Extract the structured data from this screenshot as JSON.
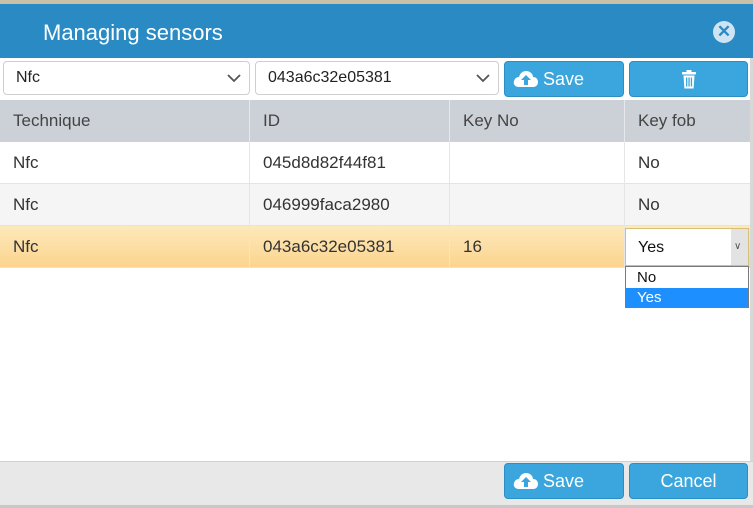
{
  "dialog": {
    "title": "Managing sensors"
  },
  "toolbar": {
    "technique_value": "Nfc",
    "id_value": "043a6c32e05381",
    "save_label": "Save"
  },
  "grid": {
    "columns": [
      "Technique",
      "ID",
      "Key No",
      "Key fob"
    ],
    "rows": [
      {
        "technique": "Nfc",
        "id": "045d8d82f44f81",
        "key_no": "",
        "key_fob": "No"
      },
      {
        "technique": "Nfc",
        "id": "046999faca2980",
        "key_no": "",
        "key_fob": "No"
      },
      {
        "technique": "Nfc",
        "id": "043a6c32e05381",
        "key_no": "16",
        "key_fob": "Yes"
      }
    ]
  },
  "editor": {
    "value": "Yes",
    "options": [
      "No",
      "Yes"
    ]
  },
  "footer": {
    "save_label": "Save",
    "cancel_label": "Cancel"
  },
  "colors": {
    "titlebar": "#2a8bc4",
    "button": "#3aa6dd",
    "selected_row": "#fcd48e",
    "header": "#ccd1d7"
  }
}
